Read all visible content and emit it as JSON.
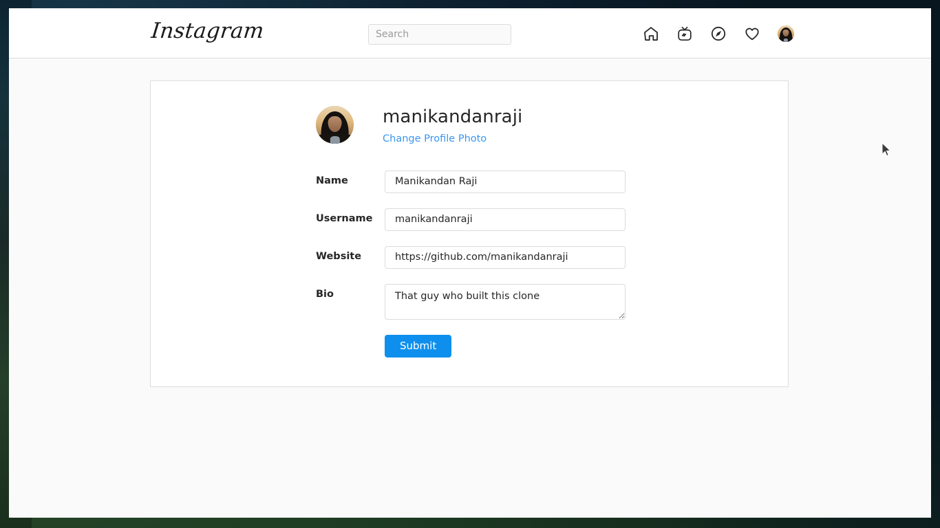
{
  "app": {
    "brand": "Instagram"
  },
  "navbar": {
    "logo_text": "Instagram",
    "search": {
      "placeholder": "Search",
      "value": ""
    },
    "icons": [
      {
        "name": "home-icon",
        "label": "Home"
      },
      {
        "name": "igtv-icon",
        "label": "IGTV"
      },
      {
        "name": "explore-compass-icon",
        "label": "Explore"
      },
      {
        "name": "heart-activity-icon",
        "label": "Activity"
      },
      {
        "name": "profile-avatar-icon",
        "label": "Profile"
      }
    ]
  },
  "profile": {
    "username": "manikandanraji",
    "change_photo_label": "Change Profile Photo",
    "avatar_alt": "manikandanraji profile photo"
  },
  "form": {
    "fields": [
      {
        "key": "name",
        "label": "Name",
        "value": "Manikandan Raji",
        "placeholder": "",
        "type": "text"
      },
      {
        "key": "username",
        "label": "Username",
        "value": "manikandanraji",
        "placeholder": "",
        "type": "text"
      },
      {
        "key": "website",
        "label": "Website",
        "value": "https://github.com/manikandanraji",
        "placeholder": "",
        "type": "text"
      },
      {
        "key": "bio",
        "label": "Bio",
        "value": "That guy who built this clone",
        "placeholder": "",
        "type": "textarea"
      }
    ],
    "submit_label": "Submit"
  },
  "colors": {
    "accent_blue": "#3897f0",
    "button_blue": "#0e8fee",
    "page_background": "#fafafa",
    "card_background": "#ffffff",
    "border": "#dbdbdb",
    "text_primary": "#262626",
    "placeholder": "#9a9a9a"
  }
}
